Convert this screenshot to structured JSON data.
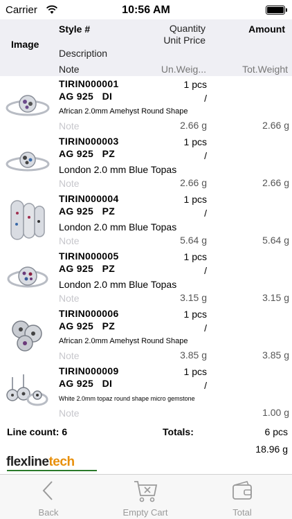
{
  "status_bar": {
    "carrier": "Carrier",
    "time": "10:56 AM"
  },
  "header": {
    "image": "Image",
    "style": "Style #",
    "quantity": "Quantity",
    "unit_price": "Unit Price",
    "amount": "Amount",
    "description": "Description",
    "note": "Note",
    "unit_weight": "Un.Weig...",
    "total_weight": "Tot.Weight"
  },
  "items": [
    {
      "code": "TIRIN000001",
      "sub": "AG 925   DI",
      "qty": "1 pcs",
      "slash": "/",
      "desc": "African 2.0mm Amehyst Round Shape",
      "note": "Note",
      "unit_weight": "2.66 g",
      "total_weight": "2.66 g"
    },
    {
      "code": "TIRIN000003",
      "sub": "AG 925   PZ",
      "qty": "1 pcs",
      "slash": "/",
      "desc": "London 2.0 mm Blue Topas",
      "note": "Note",
      "unit_weight": "2.66 g",
      "total_weight": "2.66 g"
    },
    {
      "code": "TIRIN000004",
      "sub": "AG 925   PZ",
      "qty": "1 pcs",
      "slash": "/",
      "desc": "London 2.0 mm Blue Topas",
      "note": "Note",
      "unit_weight": "5.64 g",
      "total_weight": "5.64 g"
    },
    {
      "code": "TIRIN000005",
      "sub": "AG 925   PZ",
      "qty": "1 pcs",
      "slash": "/",
      "desc": "London 2.0 mm Blue Topas",
      "note": "Note",
      "unit_weight": "3.15 g",
      "total_weight": "3.15 g"
    },
    {
      "code": "TIRIN000006",
      "sub": "AG 925   PZ",
      "qty": "1 pcs",
      "slash": "/",
      "desc": "African 2.0mm Amehyst Round Shape",
      "note": "Note",
      "unit_weight": "3.85 g",
      "total_weight": "3.85 g"
    },
    {
      "code": "TIRIN000009",
      "sub": "AG 925   DI",
      "qty": "1 pcs",
      "slash": "/",
      "desc": "White 2.0mm topaz round shape micro gemstone",
      "note": "Note",
      "unit_weight": "",
      "total_weight": "1.00 g"
    }
  ],
  "summary": {
    "line_count_label": "Line count: 6",
    "totals_label": "Totals:",
    "total_pcs": "6 pcs",
    "total_weight": "18.96 g"
  },
  "logo": {
    "part1": "flexline",
    "part2": "tech",
    "colors": {
      "tech": "#e8900c",
      "underline": "#2a7a2a"
    }
  },
  "tabbar": {
    "back": "Back",
    "empty_cart": "Empty Cart",
    "total": "Total"
  },
  "icons": [
    "wifi-icon",
    "battery-icon",
    "ring-icon",
    "back-chevron-icon",
    "cart-x-icon",
    "wallet-icon"
  ]
}
